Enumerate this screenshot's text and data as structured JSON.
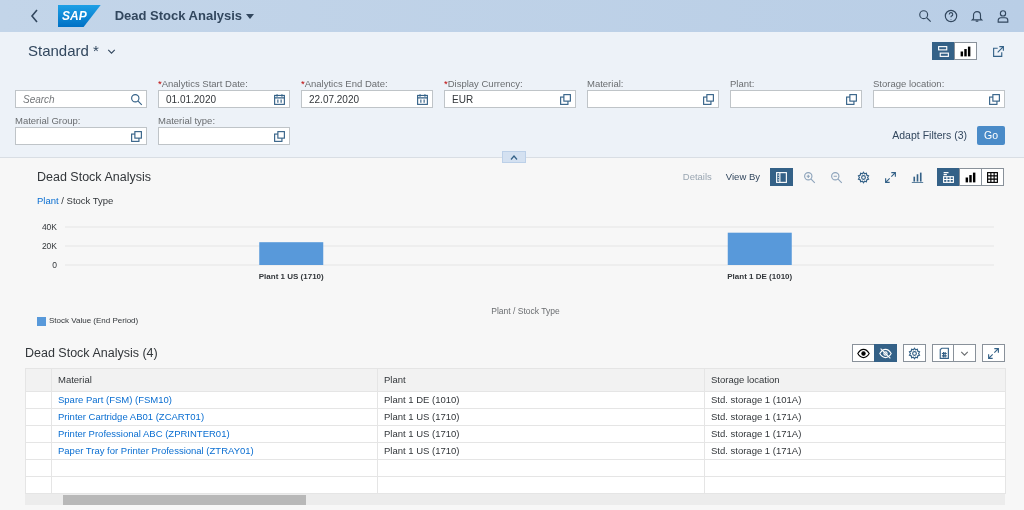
{
  "shell": {
    "app_title": "Dead Stock Analysis",
    "logo": "SAP"
  },
  "header": {
    "variant": "Standard *",
    "view_toggle": [
      {
        "kind": "filterbar",
        "selected": true
      },
      {
        "kind": "chart",
        "selected": false
      }
    ]
  },
  "filters": [
    {
      "placeholder": "Search",
      "kind": "search"
    },
    {
      "label": "Analytics Start Date:",
      "required_mark": "*",
      "value": "01.01.2020",
      "kind": "date"
    },
    {
      "label": "Analytics End Date:",
      "required_mark": "*",
      "value": "22.07.2020",
      "kind": "date"
    },
    {
      "label": "Display Currency:",
      "required_mark": "*",
      "value": "EUR",
      "kind": "valuehelp"
    },
    {
      "label": "Material:",
      "kind": "valuehelp"
    },
    {
      "label": "Plant:",
      "kind": "valuehelp"
    },
    {
      "label": "Storage location:",
      "kind": "valuehelp"
    },
    {
      "label": "Material Group:",
      "kind": "valuehelp"
    },
    {
      "label": "Material type:",
      "kind": "valuehelp"
    }
  ],
  "adapt_filters": "Adapt Filters (3)",
  "go_button": "Go",
  "chart_panel": {
    "title": "Dead Stock Analysis",
    "details": {
      "label": "Details",
      "disabled": true
    },
    "view_by": "View By",
    "tools": [
      {
        "kind": "legend",
        "selected": true
      },
      {
        "kind": "zoomin",
        "selected": false
      },
      {
        "kind": "zoomout",
        "selected": false
      },
      {
        "kind": "settings",
        "selected": false
      },
      {
        "kind": "fullscreen",
        "selected": false
      },
      {
        "kind": "charttype",
        "selected": false
      }
    ],
    "view_mode": [
      {
        "kind": "charttable",
        "selected": true
      },
      {
        "kind": "chart",
        "selected": false
      },
      {
        "kind": "table",
        "selected": false
      }
    ],
    "breadcrumb": {
      "items": [
        "Plant",
        "Stock Type"
      ],
      "separator": "/"
    },
    "chart_data": {
      "type": "bar",
      "xlabel": "Plant / Stock Type",
      "categories": [
        "Plant 1 US (1710)",
        "Plant 1 DE (1010)"
      ],
      "series": [
        {
          "name": "Stock Value (End Period)",
          "color": "#5899da",
          "values": [
            24000,
            34000
          ]
        }
      ],
      "ylim": [
        0,
        40000
      ],
      "yticks": [
        {
          "value": 0,
          "label": "0"
        },
        {
          "value": 20000,
          "label": "20K"
        },
        {
          "value": 40000,
          "label": "40K"
        }
      ]
    }
  },
  "table_panel": {
    "title": "Dead Stock Analysis (4)",
    "details_toggle": [
      {
        "kind": "show",
        "selected": false
      },
      {
        "kind": "hide",
        "selected": true
      }
    ],
    "columns": [
      "Material",
      "Plant",
      "Storage location"
    ],
    "rows": [
      [
        "Spare Part (FSM) (FSM10)",
        "Plant 1 DE (1010)",
        "Std. storage 1 (101A)"
      ],
      [
        "Printer Cartridge AB01 (ZCART01)",
        "Plant 1 US (1710)",
        "Std. storage 1 (171A)"
      ],
      [
        "Printer Professional ABC (ZPRINTER01)",
        "Plant 1 US (1710)",
        "Std. storage 1 (171A)"
      ],
      [
        "Paper Tray for Printer Professional (ZTRAY01)",
        "Plant 1 US (1710)",
        "Std. storage 1 (171A)"
      ]
    ]
  }
}
